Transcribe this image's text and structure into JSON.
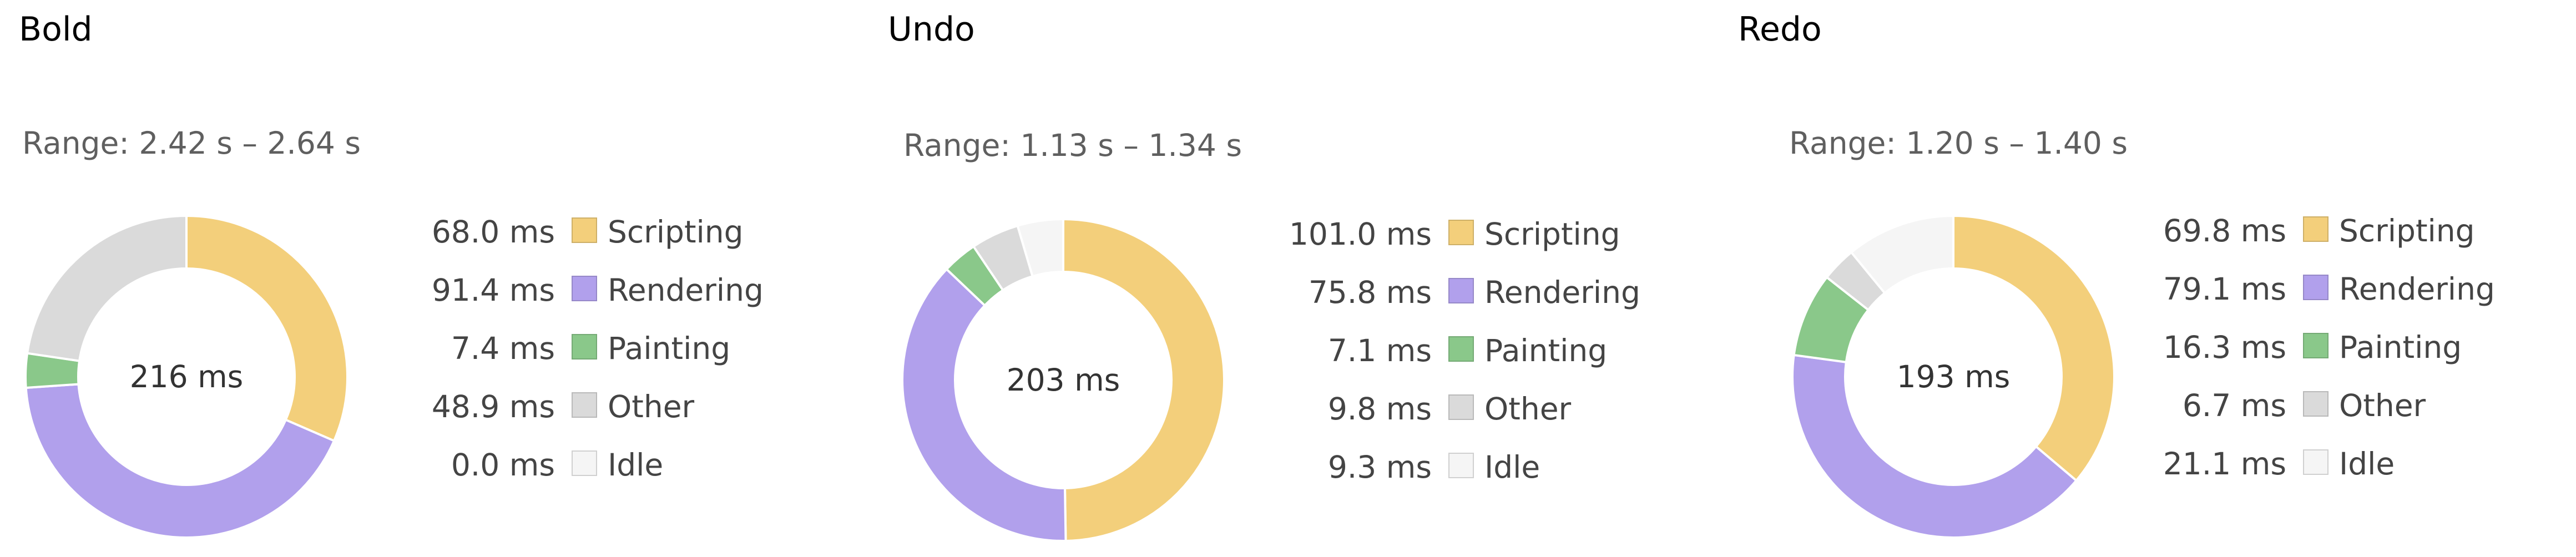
{
  "colors": {
    "Scripting": "#f3cf7b",
    "Rendering": "#b1a0ec",
    "Painting": "#8ac88a",
    "Other": "#dadada",
    "Idle": "#f5f5f5"
  },
  "chart_data": [
    {
      "type": "pie",
      "title": "Bold",
      "range": "Range: 2.42 s – 2.64 s",
      "total": "216 ms",
      "slices": [
        {
          "label": "Scripting",
          "value": 68.0,
          "value_text": "68.0 ms"
        },
        {
          "label": "Rendering",
          "value": 91.4,
          "value_text": "91.4 ms"
        },
        {
          "label": "Painting",
          "value": 7.4,
          "value_text": "7.4 ms"
        },
        {
          "label": "Other",
          "value": 48.9,
          "value_text": "48.9 ms"
        },
        {
          "label": "Idle",
          "value": 0.0,
          "value_text": "0.0 ms"
        }
      ],
      "legend": "right"
    },
    {
      "type": "pie",
      "title": "Undo",
      "range": "Range: 1.13 s – 1.34 s",
      "total": "203 ms",
      "slices": [
        {
          "label": "Scripting",
          "value": 101.0,
          "value_text": "101.0 ms"
        },
        {
          "label": "Rendering",
          "value": 75.8,
          "value_text": "75.8 ms"
        },
        {
          "label": "Painting",
          "value": 7.1,
          "value_text": "7.1 ms"
        },
        {
          "label": "Other",
          "value": 9.8,
          "value_text": "9.8 ms"
        },
        {
          "label": "Idle",
          "value": 9.3,
          "value_text": "9.3 ms"
        }
      ],
      "legend": "right"
    },
    {
      "type": "pie",
      "title": "Redo",
      "range": "Range: 1.20 s – 1.40 s",
      "total": "193 ms",
      "slices": [
        {
          "label": "Scripting",
          "value": 69.8,
          "value_text": "69.8 ms"
        },
        {
          "label": "Rendering",
          "value": 79.1,
          "value_text": "79.1 ms"
        },
        {
          "label": "Painting",
          "value": 16.3,
          "value_text": "16.3 ms"
        },
        {
          "label": "Other",
          "value": 6.7,
          "value_text": "6.7 ms"
        },
        {
          "label": "Idle",
          "value": 21.1,
          "value_text": "21.1 ms"
        }
      ],
      "legend": "right"
    }
  ]
}
